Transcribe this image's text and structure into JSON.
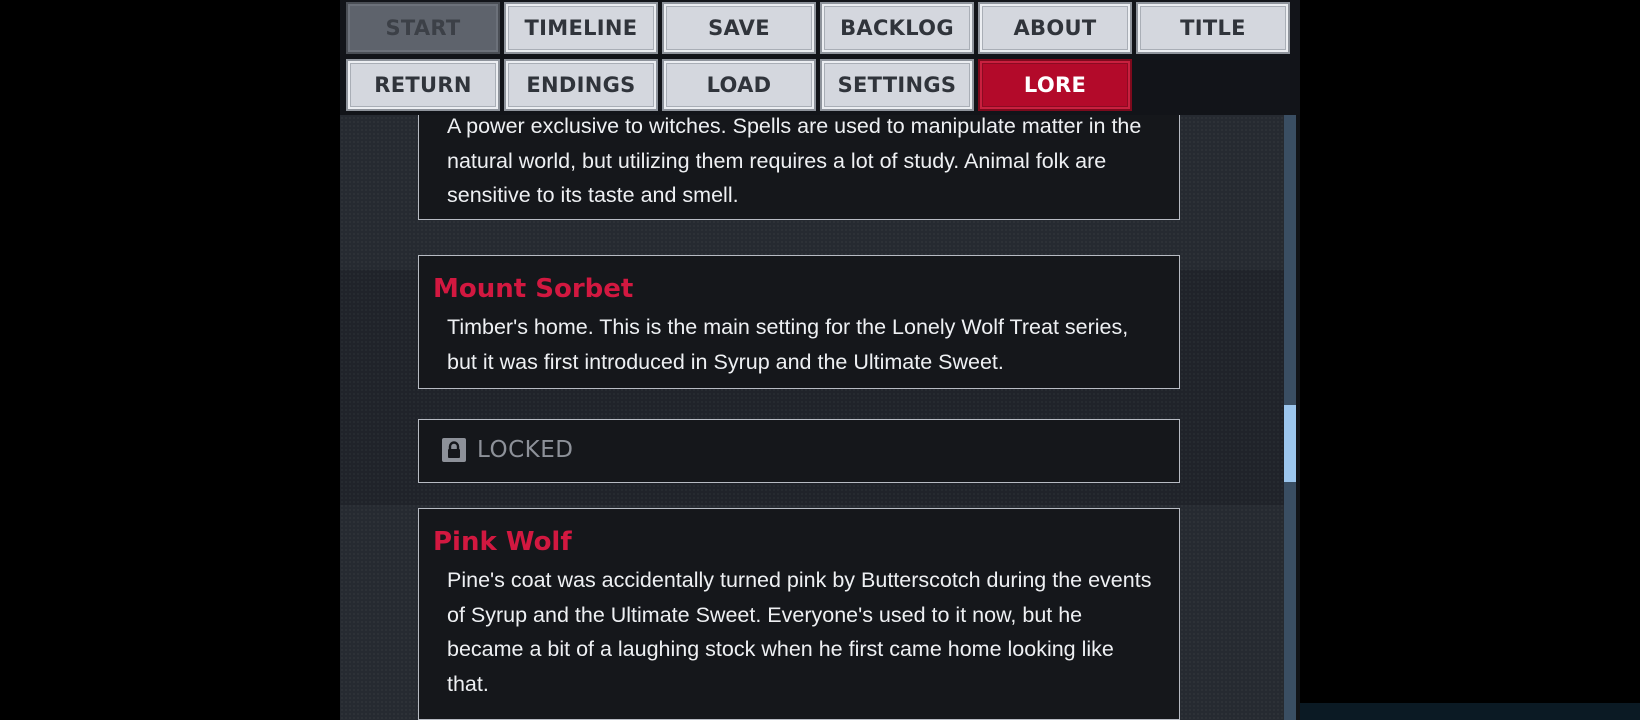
{
  "nav": {
    "row1": [
      {
        "label": "START",
        "state": "disabled"
      },
      {
        "label": "TIMELINE",
        "state": "normal"
      },
      {
        "label": "SAVE",
        "state": "normal"
      },
      {
        "label": "BACKLOG",
        "state": "normal"
      },
      {
        "label": "ABOUT",
        "state": "normal"
      },
      {
        "label": "TITLE",
        "state": "normal"
      }
    ],
    "row2": [
      {
        "label": "RETURN",
        "state": "normal"
      },
      {
        "label": "ENDINGS",
        "state": "normal"
      },
      {
        "label": "LOAD",
        "state": "normal"
      },
      {
        "label": "SETTINGS",
        "state": "normal"
      },
      {
        "label": "LORE",
        "state": "active"
      }
    ]
  },
  "lore": {
    "entries": [
      {
        "title": "",
        "body": "A power exclusive to witches. Spells are used to manipulate matter in the natural world, but utilizing them requires a lot of study. Animal folk are sensitive to its taste and smell."
      },
      {
        "title": "Mount Sorbet",
        "body": "Timber's home. This is the main setting for the Lonely Wolf Treat series, but it was first introduced in Syrup and the Ultimate Sweet."
      },
      {
        "locked": true,
        "label": "LOCKED"
      },
      {
        "title": "Pink Wolf",
        "body": "Pine's coat was accidentally turned pink by Butterscotch during the events of Syrup and the Ultimate Sweet. Everyone's used to it now, but he became a bit of a laughing stock when he first came home looking like that."
      }
    ]
  },
  "scroll": {
    "position_fraction": 0.55
  },
  "colors": {
    "accent_red": "#b30a2a",
    "lore_title": "#d21840",
    "button_face": "#d4d7de",
    "panel_bg": "#22262d",
    "scroll_thumb": "#9cc6ee"
  }
}
